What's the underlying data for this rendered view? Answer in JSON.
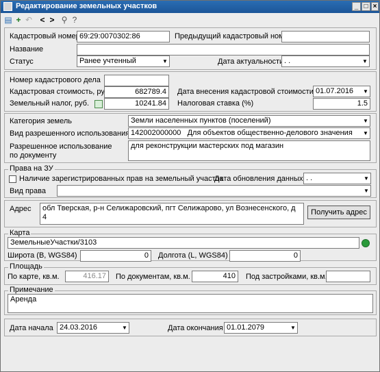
{
  "window": {
    "title": "Редактирование земельных участков"
  },
  "toolbar": {
    "items": [
      "save-icon",
      "add-icon",
      "undo-icon",
      "prev-icon",
      "next-icon",
      "link-icon",
      "help-icon"
    ]
  },
  "main": {
    "cadastral_label": "Кадастровый номер",
    "cadastral_value": "69:29:0070302:86",
    "prev_cadastral_label": "Предыдущий кадастровый номер",
    "prev_cadastral_value": "",
    "name_label": "Название",
    "name_value": "",
    "status_label": "Статус",
    "status_value": "Ранее учтенный",
    "actual_date_label": "Дата актуальности",
    "actual_date_value": ". ."
  },
  "cost": {
    "case_label": "Номер кадастрового дела",
    "case_value": "",
    "value_label": "Кадастровая стоимость, руб.",
    "value_value": "682789.4",
    "entry_date_label": "Дата внесения кадастровой стоимости",
    "entry_date_value": "01.07.2016",
    "tax_label": "Земельный налог, руб.",
    "tax_value": "10241.84",
    "rate_label": "Налоговая ставка (%)",
    "rate_value": "1.5"
  },
  "land": {
    "category_label": "Категория земель",
    "category_value": "Земли населенных  пунктов (поселений)",
    "use_label": "Вид разрешенного использования",
    "use_code": "142002000000",
    "use_value": "Для объектов общественно-делового значения",
    "doc_use_label_1": "Разрешенное использование",
    "doc_use_label_2": "по документу",
    "doc_use_value": "для реконструкции мастерских под магазин"
  },
  "rights": {
    "legend": "Права на ЗУ",
    "registered_label": "Наличие зарегистрированных прав на земельный участок",
    "update_label": "Дата обновления данных",
    "update_value": ". .",
    "type_label": "Вид права",
    "type_value": ""
  },
  "address": {
    "label": "Адрес",
    "value": "обл Тверская, р-н Селижаровский, пгт Селижарово, ул Вознесенского, д 4",
    "button": "Получить адрес"
  },
  "map": {
    "legend": "Карта",
    "layer_value": "ЗемельныеУчастки/3103",
    "lat_label": "Широта (B, WGS84)",
    "lat_value": "0",
    "lon_label": "Долгота (L, WGS84)",
    "lon_value": "0"
  },
  "area": {
    "legend": "Площадь",
    "map_label": "По карте, кв.м.",
    "map_value": "416.17",
    "doc_label": "По документам, кв.м.",
    "doc_value": "410",
    "built_label": "Под застройками, кв.м.",
    "built_value": ""
  },
  "note": {
    "legend": "Примечание",
    "value": "Аренда"
  },
  "dates": {
    "start_label": "Дата начала",
    "start_value": "24.03.2016",
    "end_label": "Дата окончания",
    "end_value": "01.01.2079"
  },
  "colors": {
    "titlebar": "#1c5598",
    "green_icon": "#2a9a3a"
  }
}
